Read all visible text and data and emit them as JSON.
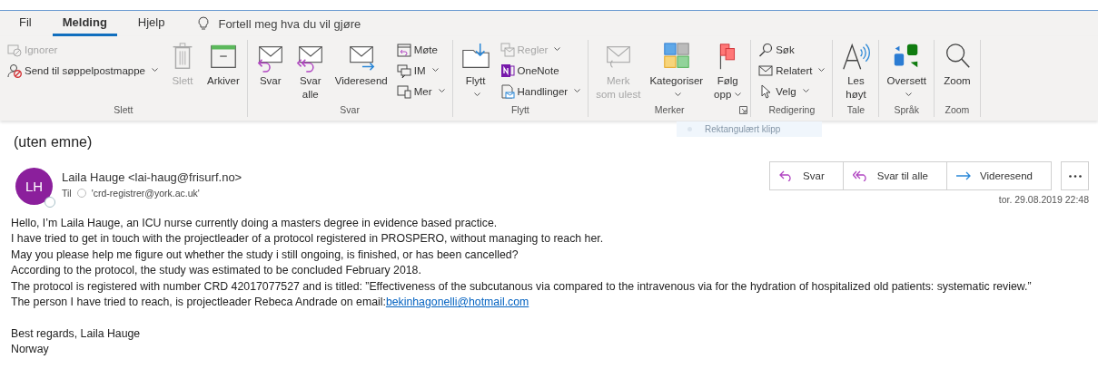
{
  "menu_tabs": [
    {
      "label": "Fil",
      "selected": false
    },
    {
      "label": "Melding",
      "selected": true
    },
    {
      "label": "Hjelp",
      "selected": false
    }
  ],
  "tell_me": {
    "placeholder": "Fortell meg hva du vil gjøre"
  },
  "ribbon_groups": [
    {
      "label": "Slett",
      "items": [
        {
          "kind": "small",
          "label": "Ignorer",
          "disabled": true,
          "dropdown": false
        },
        {
          "kind": "small",
          "label": "Send til søppelpostmappe",
          "disabled": false,
          "dropdown": true
        },
        {
          "kind": "large",
          "lines": [
            "Slett"
          ],
          "disabled": true,
          "dropdown": false
        },
        {
          "kind": "large",
          "lines": [
            "Arkiver"
          ],
          "disabled": false,
          "dropdown": false
        }
      ]
    },
    {
      "label": "Svar",
      "items": [
        {
          "kind": "large",
          "lines": [
            "Svar"
          ],
          "disabled": false,
          "dropdown": false
        },
        {
          "kind": "large",
          "lines": [
            "Svar",
            "alle"
          ],
          "disabled": false,
          "dropdown": false
        },
        {
          "kind": "large",
          "lines": [
            "Videresend"
          ],
          "disabled": false,
          "dropdown": false
        },
        {
          "kind": "small",
          "label": "Møte",
          "disabled": false,
          "dropdown": false
        },
        {
          "kind": "small",
          "label": "IM",
          "disabled": false,
          "dropdown": true
        },
        {
          "kind": "small",
          "label": "Mer",
          "disabled": false,
          "dropdown": true
        }
      ]
    },
    {
      "label": "Flytt",
      "items": [
        {
          "kind": "large",
          "lines": [
            "Flytt"
          ],
          "disabled": false,
          "dropdown": true
        },
        {
          "kind": "small",
          "label": "Regler",
          "disabled": true,
          "dropdown": true
        },
        {
          "kind": "small",
          "label": "OneNote",
          "disabled": false,
          "dropdown": false
        },
        {
          "kind": "small",
          "label": "Handlinger",
          "disabled": false,
          "dropdown": true
        }
      ]
    },
    {
      "label": "Merker",
      "launcher": true,
      "items": [
        {
          "kind": "large",
          "lines": [
            "Merk",
            "som ulest"
          ],
          "disabled": true,
          "dropdown": false
        },
        {
          "kind": "large",
          "lines": [
            "Kategoriser"
          ],
          "disabled": false,
          "dropdown": true
        },
        {
          "kind": "large",
          "lines": [
            "Følg",
            "opp"
          ],
          "disabled": false,
          "dropdown": true
        }
      ]
    },
    {
      "label": "Redigering",
      "items": [
        {
          "kind": "small",
          "label": "Søk",
          "disabled": false,
          "dropdown": false
        },
        {
          "kind": "small",
          "label": "Relatert",
          "disabled": false,
          "dropdown": true
        },
        {
          "kind": "small",
          "label": "Velg",
          "disabled": false,
          "dropdown": true
        }
      ]
    },
    {
      "label": "Tale",
      "items": [
        {
          "kind": "large",
          "lines": [
            "Les",
            "høyt"
          ],
          "disabled": false,
          "dropdown": false
        }
      ]
    },
    {
      "label": "Språk",
      "items": [
        {
          "kind": "large",
          "lines": [
            "Oversett"
          ],
          "disabled": false,
          "dropdown": true
        }
      ]
    },
    {
      "label": "Zoom",
      "items": [
        {
          "kind": "large",
          "lines": [
            "Zoom"
          ],
          "disabled": false,
          "dropdown": false
        }
      ]
    }
  ],
  "overlay_hint": {
    "label": "Rektangulært klipp"
  },
  "message": {
    "subject": "(uten emne)",
    "avatar_initials": "LH",
    "sender": "Laila Hauge <lai-haug@frisurf.no>",
    "to_label": "Til",
    "recipient": "'crd-registrer@york.ac.uk'",
    "date": "tor. 29.08.2019 22:48",
    "actions": [
      {
        "kind": "reply",
        "label": "Svar"
      },
      {
        "kind": "reply_all",
        "label": "Svar til alle"
      },
      {
        "kind": "forward",
        "label": "Videresend"
      }
    ],
    "body": [
      {
        "text": "Hello, I’m Laila Hauge, an ICU nurse currently doing a masters degree in evidence based practice."
      },
      {
        "text": "I have tried to get in touch with the projectleader of a protocol registered in PROSPERO, without managing to reach her."
      },
      {
        "text": "May you please help me figure out whether the study i still ongoing, is finished, or has been cancelled?"
      },
      {
        "text": "According to the protocol, the study was estimated to be concluded February 2018."
      },
      {
        "text": "The protocol is registered with number CRD 42017077527  and is titled: ”Effectiveness of the subcutanous via compared to the intravenous via for the hydration of hospitalized old patients: systematic review.”"
      },
      {
        "text": "The person I have tried to reach, is projectleader Rebeca Andrade on email:",
        "link": "bekinhagonelli@hotmail.com"
      },
      {
        "kind": "blank"
      },
      {
        "text": "Best regards, Laila Hauge"
      },
      {
        "text": "Norway"
      }
    ]
  }
}
